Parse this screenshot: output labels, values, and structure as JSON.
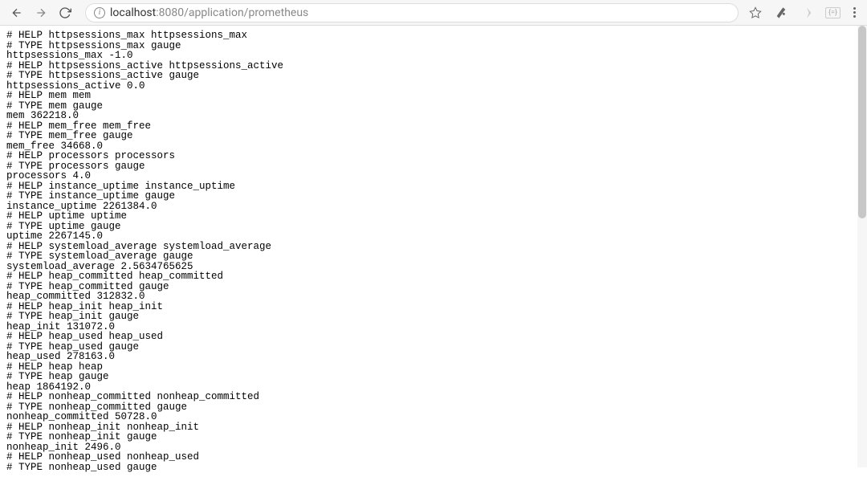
{
  "address": {
    "info_glyph": "i",
    "domain": "localhost",
    "port_path": ":8080/application/prometheus"
  },
  "ext": {
    "badge": "{=}"
  },
  "metrics": [
    {
      "name": "httpsessions_max",
      "help": "httpsessions_max",
      "type": "gauge",
      "value": "-1.0"
    },
    {
      "name": "httpsessions_active",
      "help": "httpsessions_active",
      "type": "gauge",
      "value": "0.0"
    },
    {
      "name": "mem",
      "help": "mem",
      "type": "gauge",
      "value": "362218.0"
    },
    {
      "name": "mem_free",
      "help": "mem_free",
      "type": "gauge",
      "value": "34668.0"
    },
    {
      "name": "processors",
      "help": "processors",
      "type": "gauge",
      "value": "4.0"
    },
    {
      "name": "instance_uptime",
      "help": "instance_uptime",
      "type": "gauge",
      "value": "2261384.0"
    },
    {
      "name": "uptime",
      "help": "uptime",
      "type": "gauge",
      "value": "2267145.0"
    },
    {
      "name": "systemload_average",
      "help": "systemload_average",
      "type": "gauge",
      "value": "2.5634765625"
    },
    {
      "name": "heap_committed",
      "help": "heap_committed",
      "type": "gauge",
      "value": "312832.0"
    },
    {
      "name": "heap_init",
      "help": "heap_init",
      "type": "gauge",
      "value": "131072.0"
    },
    {
      "name": "heap_used",
      "help": "heap_used",
      "type": "gauge",
      "value": "278163.0"
    },
    {
      "name": "heap",
      "help": "heap",
      "type": "gauge",
      "value": "1864192.0"
    },
    {
      "name": "nonheap_committed",
      "help": "nonheap_committed",
      "type": "gauge",
      "value": "50728.0"
    },
    {
      "name": "nonheap_init",
      "help": "nonheap_init",
      "type": "gauge",
      "value": "2496.0"
    },
    {
      "name": "nonheap_used",
      "help": "nonheap_used",
      "type": "gauge",
      "value": null
    }
  ]
}
